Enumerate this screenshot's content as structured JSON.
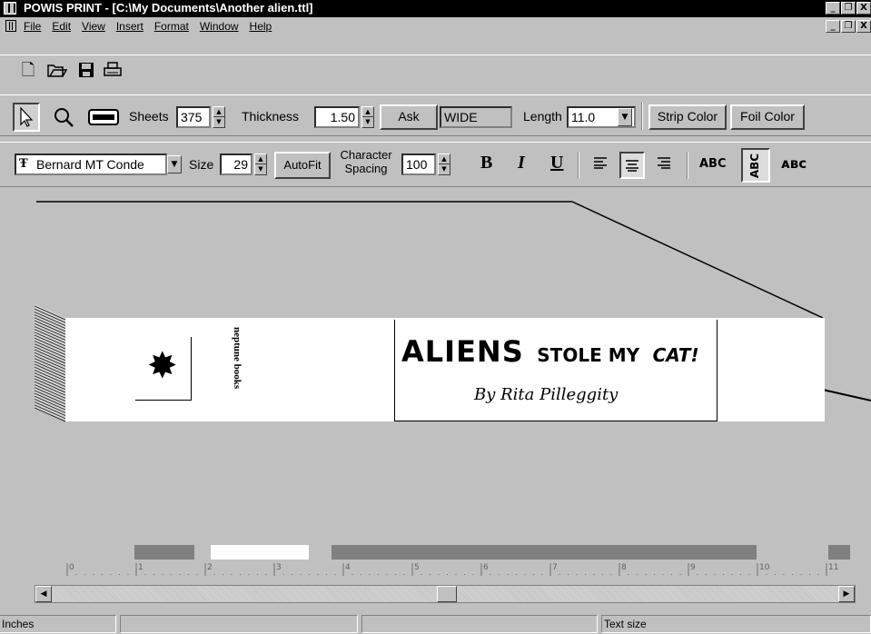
{
  "titlebar": {
    "title": "POWIS PRINT - [C:\\My Documents\\Another alien.ttl]",
    "minimize": "_",
    "restore": "❐",
    "close": "X"
  },
  "menubar": {
    "items": [
      "File",
      "Edit",
      "View",
      "Insert",
      "Format",
      "Window",
      "Help"
    ]
  },
  "toolbar_tools": {
    "sheets_label": "Sheets",
    "sheets_value": "375",
    "thickness_label": "Thickness",
    "thickness_value": "1.50",
    "ask_label": "Ask",
    "wide_value": "WIDE",
    "length_label": "Length",
    "length_value": "11.0",
    "strip_color_label": "Strip Color",
    "foil_color_label": "Foil Color"
  },
  "toolbar_format": {
    "font_value": "Bernard MT Conde",
    "size_label": "Size",
    "size_value": "29",
    "autofit_label": "AutoFit",
    "char_label_1": "Character",
    "char_label_2": "Spacing",
    "spacing_value": "100",
    "bold": "B",
    "italic": "I",
    "underline": "U",
    "orient_horizontal": "ABC",
    "orient_vertical": "ABC",
    "orient_stacked": "ᴀʙᴄ"
  },
  "spine": {
    "logo_glyph": "✸",
    "publisher": "neptune books",
    "title_main": "ALIENS",
    "title_sub": "STOLE MY",
    "title_end": "CAT!",
    "byline": "By Rita Pilleggity"
  },
  "ruler": {
    "ticks": [
      "0",
      "1",
      "2",
      "3",
      "4",
      "5",
      "6",
      "7",
      "8",
      "9",
      "10",
      "11"
    ]
  },
  "statusbar": {
    "units": "Inches",
    "hint": "Text size"
  },
  "colors": {
    "panel": "#c0c0c0",
    "ruler_block_dark": "#808080",
    "ruler_block_white": "#ffffff"
  }
}
